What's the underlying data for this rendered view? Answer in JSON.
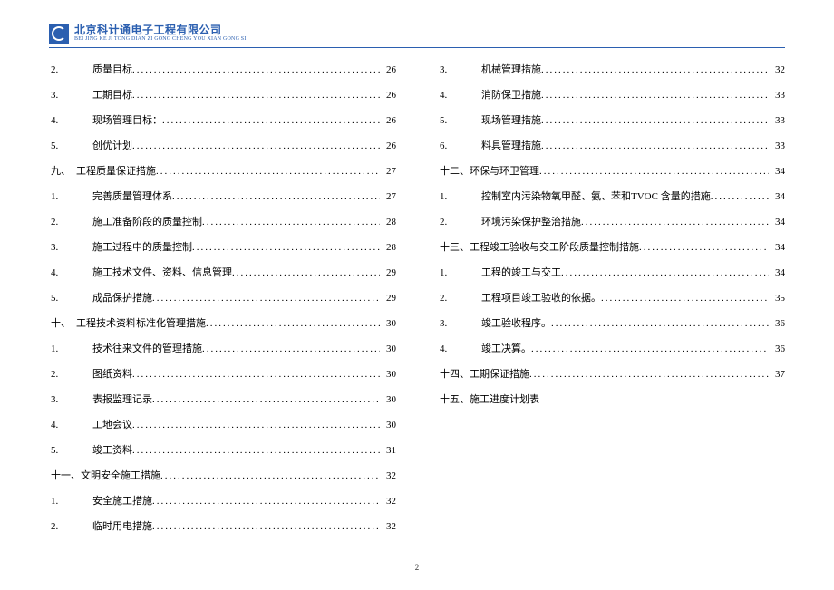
{
  "header": {
    "company_cn": "北京科计通电子工程有限公司",
    "company_en": "BEI JING KE JI TONG DIAN ZI GONG CHENG YOU XIAN GONG SI"
  },
  "page_number": "2",
  "toc": [
    {
      "num": "2.",
      "title": "质量目标",
      "page": "26",
      "indent": "sub"
    },
    {
      "num": "3.",
      "title": "工期目标",
      "page": "26",
      "indent": "sub"
    },
    {
      "num": "4.",
      "title": "现场管理目标：",
      "page": "26",
      "indent": "sub"
    },
    {
      "num": "5.",
      "title": "创优计划",
      "page": "26",
      "indent": "sub"
    },
    {
      "num": "九、",
      "title": "工程质量保证措施",
      "page": "27",
      "indent": "sec"
    },
    {
      "num": "1.",
      "title": "完善质量管理体系",
      "page": "27",
      "indent": "sub"
    },
    {
      "num": "2.",
      "title": "施工准备阶段的质量控制",
      "page": "28",
      "indent": "sub"
    },
    {
      "num": "3.",
      "title": "施工过程中的质量控制",
      "page": "28",
      "indent": "sub"
    },
    {
      "num": "4.",
      "title": "施工技术文件、资料、信息管理",
      "page": "29",
      "indent": "sub"
    },
    {
      "num": "5.",
      "title": "成品保护措施",
      "page": "29",
      "indent": "sub"
    },
    {
      "num": "十、",
      "title": "工程技术资料标准化管理措施",
      "page": "30",
      "indent": "sec"
    },
    {
      "num": "1.",
      "title": "技术往来文件的管理措施",
      "page": "30",
      "indent": "sub"
    },
    {
      "num": "2.",
      "title": "图纸资料",
      "page": "30",
      "indent": "sub"
    },
    {
      "num": "3.",
      "title": "表报监理记录",
      "page": "30",
      "indent": "sub"
    },
    {
      "num": "4.",
      "title": "工地会议",
      "page": "30",
      "indent": "sub"
    },
    {
      "num": "5.",
      "title": "竣工资料",
      "page": "31",
      "indent": "sub"
    },
    {
      "num": "十一、",
      "title": "文明安全施工措施",
      "page": "32",
      "indent": "sec"
    },
    {
      "num": "1.",
      "title": "安全施工措施",
      "page": "32",
      "indent": "sub"
    },
    {
      "num": "2.",
      "title": "临时用电措施",
      "page": "32",
      "indent": "sub"
    },
    {
      "num": "3.",
      "title": "机械管理措施",
      "page": "32",
      "indent": "sub"
    },
    {
      "num": "4.",
      "title": "消防保卫措施",
      "page": "33",
      "indent": "sub"
    },
    {
      "num": "5.",
      "title": "现场管理措施",
      "page": "33",
      "indent": "sub"
    },
    {
      "num": "6.",
      "title": "料具管理措施",
      "page": "33",
      "indent": "sub"
    },
    {
      "num": "十二、",
      "title": "环保与环卫管理",
      "page": "34",
      "indent": "sec"
    },
    {
      "num": "1.",
      "title": "控制室内污染物氧甲醛、氨、苯和TVOC 含量的措施",
      "page": "34",
      "indent": "sub"
    },
    {
      "num": "2.",
      "title": "环境污染保护整治措施",
      "page": "34",
      "indent": "sub"
    },
    {
      "num": "十三、",
      "title": "工程竣工验收与交工阶段质量控制措施",
      "page": "34",
      "indent": "sec"
    },
    {
      "num": "1.",
      "title": "工程的竣工与交工",
      "page": "34",
      "indent": "sub"
    },
    {
      "num": "2.",
      "title": "工程项目竣工验收的依据。",
      "page": "35",
      "indent": "sub"
    },
    {
      "num": "3.",
      "title": "竣工验收程序。",
      "page": "36",
      "indent": "sub"
    },
    {
      "num": "4.",
      "title": "竣工决算。",
      "page": "36",
      "indent": "sub"
    },
    {
      "num": "十四、",
      "title": "工期保证措施",
      "page": "37",
      "indent": "sec"
    },
    {
      "num": "十五、",
      "title": "施工进度计划表",
      "page": "",
      "indent": "sec",
      "nopage": true
    }
  ]
}
